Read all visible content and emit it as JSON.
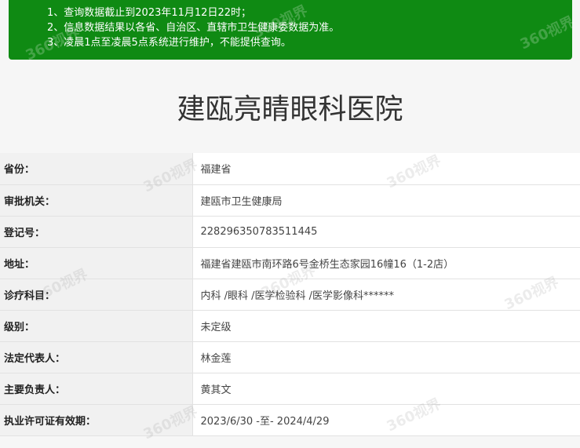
{
  "notice": {
    "lines": [
      "1、查询数据截止到2023年11月12日22时；",
      "2、信息数据结果以各省、自治区、直辖市卫生健康委数据为准。",
      "3、凌晨1点至凌晨5点系统进行维护，不能提供查询。"
    ]
  },
  "hospital": {
    "name": "建瓯亮睛眼科医院"
  },
  "fields": [
    {
      "label": "省份：",
      "value": "福建省"
    },
    {
      "label": "审批机关：",
      "value": "建瓯市卫生健康局"
    },
    {
      "label": "登记号：",
      "value": "228296350783511445"
    },
    {
      "label": "地址：",
      "value": "福建省建瓯市南环路6号金桥生态家园16幢16（1-2店）"
    },
    {
      "label": "诊疗科目：",
      "value": "内科 /眼科 /医学检验科 /医学影像科******"
    },
    {
      "label": "级别：",
      "value": "未定级"
    },
    {
      "label": "法定代表人：",
      "value": "林金莲"
    },
    {
      "label": "主要负责人：",
      "value": "黄其文"
    },
    {
      "label": "执业许可证有效期：",
      "value": "2023/6/30 -至- 2024/4/29"
    }
  ],
  "watermark": {
    "text": "360视界"
  },
  "colors": {
    "notice_bg": "#0f8a13",
    "label_bg": "#f1f1f1",
    "value_bg": "#ffffff"
  }
}
